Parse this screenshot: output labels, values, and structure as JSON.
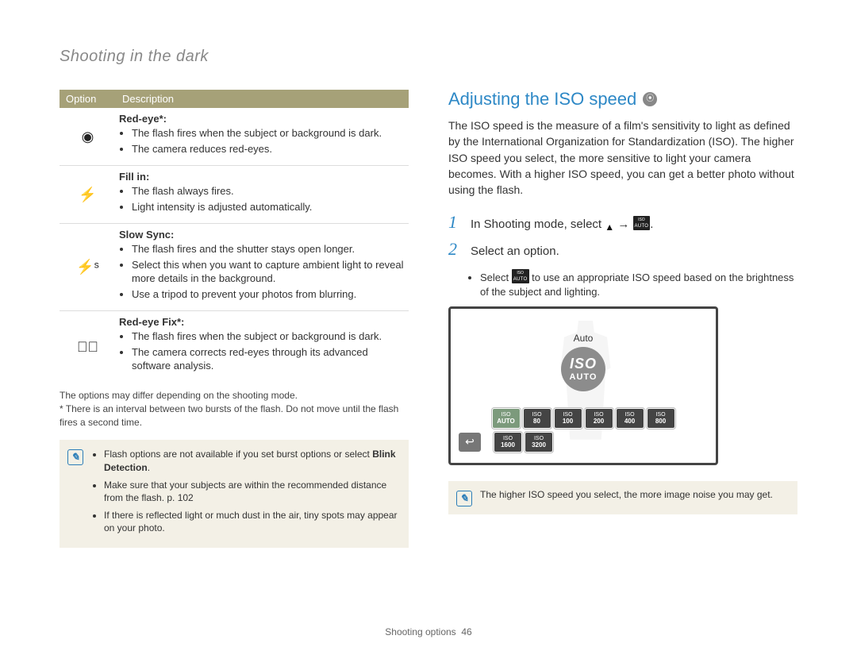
{
  "chapter": "Shooting in the dark",
  "flashTable": {
    "headers": {
      "option": "Option",
      "description": "Description"
    },
    "rows": [
      {
        "iconGlyph": "◉",
        "name": "Red-eye*:",
        "bullets": [
          "The flash fires when the subject or background is dark.",
          "The camera reduces red-eyes."
        ]
      },
      {
        "iconGlyph": "⚡",
        "name": "Fill in:",
        "bullets": [
          "The flash always fires.",
          "Light intensity is adjusted automatically."
        ]
      },
      {
        "iconGlyph": "⚡ˢ",
        "name": "Slow Sync:",
        "bullets": [
          "The flash fires and the shutter stays open longer.",
          "Select this when you want to capture ambient light to reveal more details in the background.",
          "Use a tripod to prevent your photos from blurring."
        ]
      },
      {
        "iconGlyph": "👁⃠",
        "name": "Red-eye Fix*:",
        "bullets": [
          "The flash fires when the subject or background is dark.",
          "The camera corrects red-eyes through its advanced software analysis."
        ]
      }
    ]
  },
  "footnotes": [
    "The options may differ depending on the shooting mode.",
    "* There is an interval between two bursts of the flash. Do not move until the flash fires a second time."
  ],
  "leftNote": {
    "items": [
      {
        "pre": "Flash options are not available if you set burst options or select ",
        "bold": "Blink Detection",
        "post": "."
      },
      {
        "pre": "Make sure that your subjects are within the recommended distance from the flash. p. 102",
        "bold": "",
        "post": ""
      },
      {
        "pre": "If there is reflected light or much dust in the air, tiny spots may appear on your photo.",
        "bold": "",
        "post": ""
      }
    ]
  },
  "rightSection": {
    "title": "Adjusting the ISO speed",
    "body": "The ISO speed is the measure of a film's sensitivity to light as defined by the International Organization for Standardization (ISO). The higher ISO speed you select, the more sensitive to light your camera becomes. With a higher ISO speed, you can get a better photo without using the flash.",
    "steps": [
      {
        "num": "1",
        "text_pre": "In Shooting mode, select ",
        "text_post": "."
      },
      {
        "num": "2",
        "text_pre": "Select an option.",
        "text_post": ""
      }
    ],
    "step2sub_pre": "Select ",
    "step2sub_post": " to use an appropriate ISO speed based on the brightness of the subject and lighting.",
    "screen": {
      "label": "Auto",
      "bigTop": "ISO",
      "bigBottom": "AUTO",
      "row1": [
        "AUTO",
        "80",
        "100",
        "200",
        "400",
        "800"
      ],
      "row2": [
        "1600",
        "3200"
      ],
      "isoPrefix": "ISO"
    },
    "note": "The higher ISO speed you select, the more image noise you may get."
  },
  "footer": {
    "section": "Shooting options",
    "page": "46"
  }
}
